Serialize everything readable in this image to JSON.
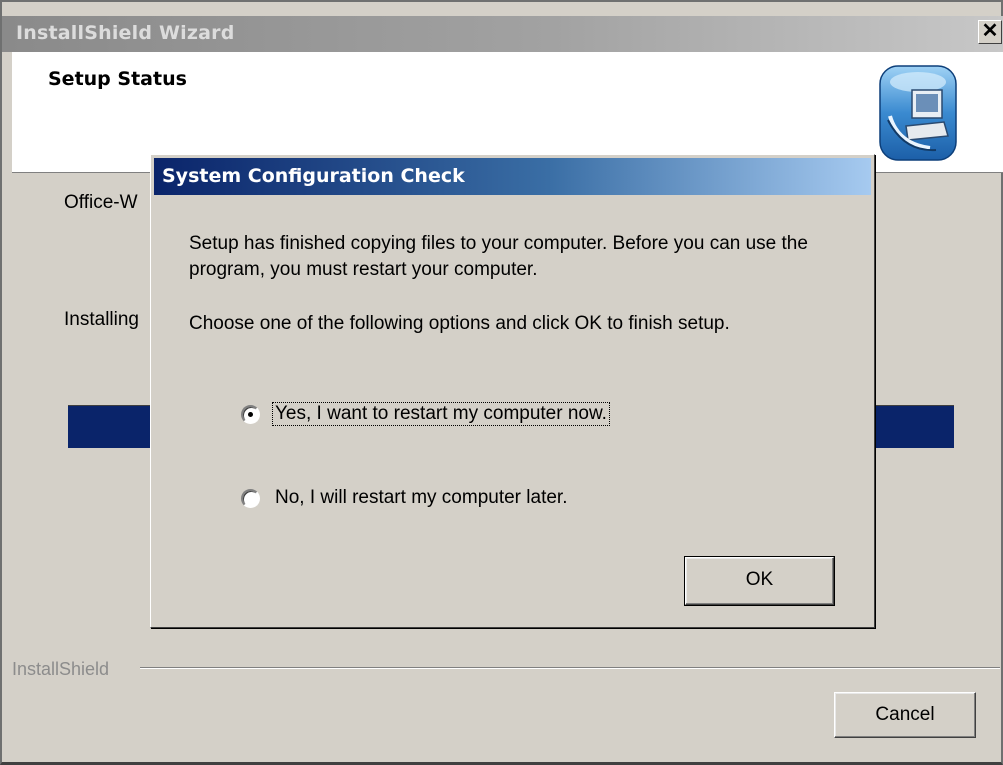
{
  "wizard": {
    "title": "InstallShield Wizard",
    "close_glyph": "✕",
    "heading": "Setup Status",
    "status_line_1": "Office-W",
    "status_line_2": "Installing",
    "brand": "InstallShield",
    "cancel_label": "Cancel",
    "progress_fraction": 1.0
  },
  "dialog": {
    "title": "System Configuration Check",
    "message": "Setup has finished copying files to your computer.  Before you can use the program, you must restart your computer.",
    "instruction": "Choose one of the following options and click OK to finish setup.",
    "options": [
      {
        "label": "Yes, I want to restart my computer now.",
        "selected": true
      },
      {
        "label": "No, I will restart my computer later.",
        "selected": false
      }
    ],
    "ok_label": "OK"
  },
  "colors": {
    "dialog_title_start": "#0a246a",
    "dialog_title_end": "#a6caf0",
    "progress": "#0a246a",
    "face": "#d4d0c8"
  },
  "icons": [
    "close-icon",
    "installshield-logo-icon",
    "radio-button"
  ]
}
